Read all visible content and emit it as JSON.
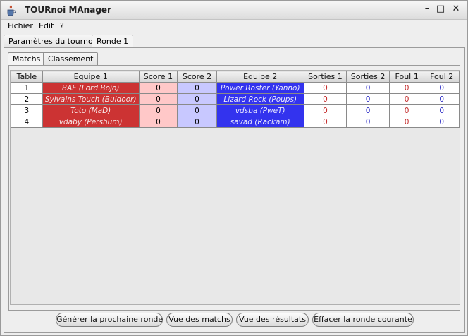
{
  "window": {
    "title": "TOURnoi MAnager",
    "minimize": "–",
    "maximize": "□",
    "close": "✕"
  },
  "menu": [
    "Fichier",
    "Edit",
    "?"
  ],
  "outer_tabs": [
    "Paramètres du tournoi",
    "Ronde 1"
  ],
  "inner_tabs": [
    "Matchs",
    "Classement"
  ],
  "table": {
    "headers": [
      "Table",
      "Equipe 1",
      "Score 1",
      "Score 2",
      "Equipe 2",
      "Sorties 1",
      "Sorties 2",
      "Foul 1",
      "Foul 2"
    ],
    "rows": [
      [
        "1",
        "BAF (Lord Bojo)",
        "0",
        "0",
        "Power Roster (Yanno)",
        "0",
        "0",
        "0",
        "0"
      ],
      [
        "2",
        "Sylvains Touch (Buldoor)",
        "0",
        "0",
        "Lizard Rock (Poups)",
        "0",
        "0",
        "0",
        "0"
      ],
      [
        "3",
        "Toto (MaD)",
        "0",
        "0",
        "vdsba (PweT)",
        "0",
        "0",
        "0",
        "0"
      ],
      [
        "4",
        "vdaby (Pershum)",
        "0",
        "0",
        "savad (Rackam)",
        "0",
        "0",
        "0",
        "0"
      ]
    ]
  },
  "buttons": {
    "next_round": "Générer la prochaine ronde",
    "matches_view": "Vue des matchs",
    "results_view": "Vue des résultats",
    "clear_round": "Effacer la ronde courante"
  },
  "colors": {
    "team1": "#cc3333",
    "team2": "#3333ee",
    "score1": "#ffc8c8",
    "score2": "#c8c8ff"
  }
}
